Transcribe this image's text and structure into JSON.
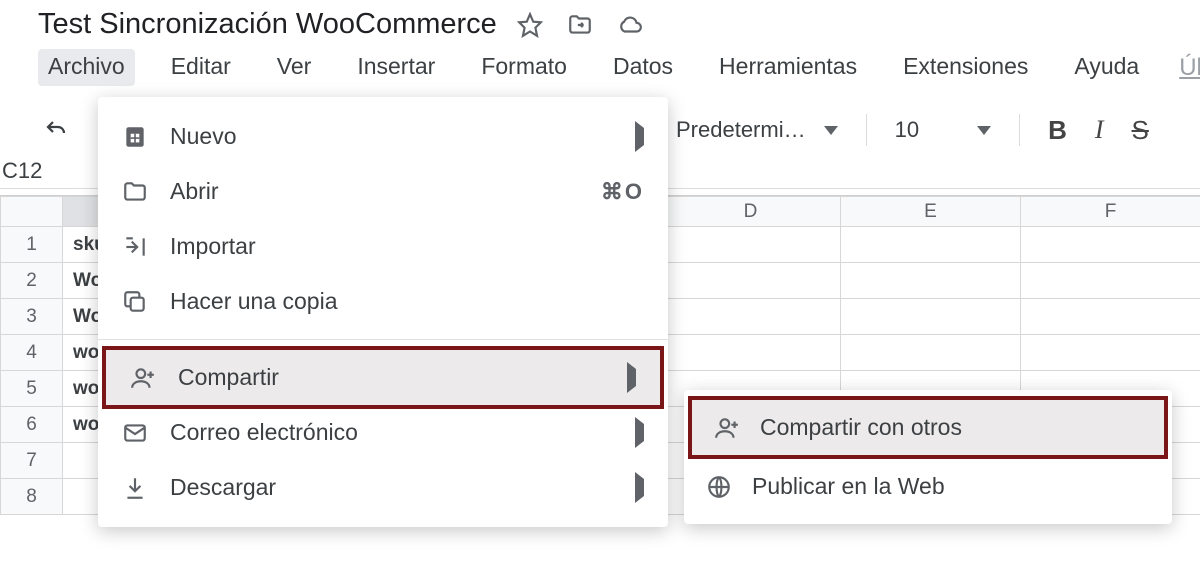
{
  "doc_title": "Test Sincronización WooCommerce",
  "menubar": {
    "items": [
      "Archivo",
      "Editar",
      "Ver",
      "Insertar",
      "Formato",
      "Datos",
      "Herramientas",
      "Extensiones",
      "Ayuda"
    ],
    "last_edit": "Úl"
  },
  "toolbar": {
    "font": "Predetermi…",
    "font_size": "10",
    "bold": "B",
    "italic": "I",
    "strike": "S"
  },
  "namebox": "C12",
  "columns": [
    "",
    "",
    "",
    "D",
    "E",
    "F",
    ""
  ],
  "rows": [
    {
      "n": "1",
      "b": "sku"
    },
    {
      "n": "2",
      "b": "Wo"
    },
    {
      "n": "3",
      "b": "Wo"
    },
    {
      "n": "4",
      "b": "wo"
    },
    {
      "n": "5",
      "b": "wo"
    },
    {
      "n": "6",
      "b": "wo"
    },
    {
      "n": "7",
      "b": ""
    },
    {
      "n": "8",
      "b": ""
    }
  ],
  "archivo_menu": {
    "nuevo": "Nuevo",
    "abrir": "Abrir",
    "abrir_shortcut": "⌘O",
    "importar": "Importar",
    "hacer_copia": "Hacer una copia",
    "compartir": "Compartir",
    "correo": "Correo electrónico",
    "descargar": "Descargar"
  },
  "compartir_submenu": {
    "con_otros": "Compartir con otros",
    "publicar": "Publicar en la Web"
  }
}
